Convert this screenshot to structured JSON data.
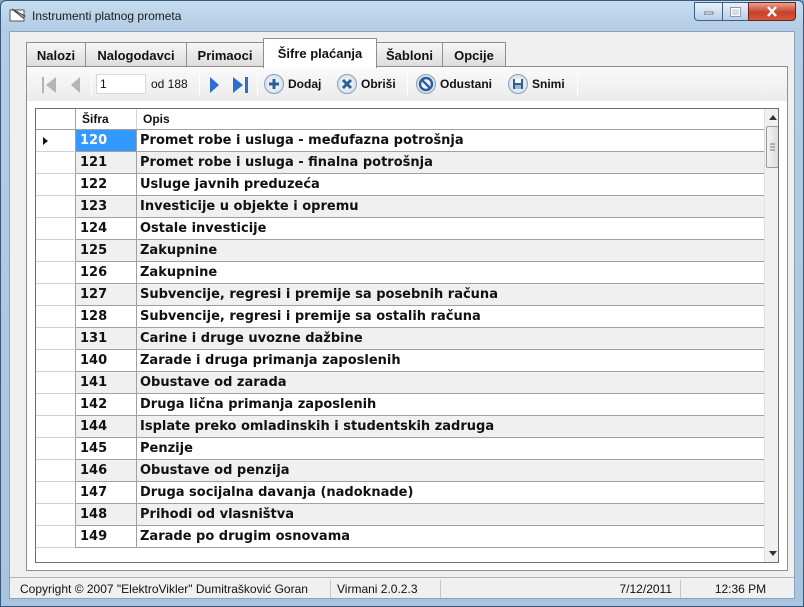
{
  "window": {
    "title": "Instrumenti platnog prometa"
  },
  "tabs": [
    {
      "label": "Nalozi"
    },
    {
      "label": "Nalogodavci"
    },
    {
      "label": "Primaoci"
    },
    {
      "label": "Šifre plaćanja"
    },
    {
      "label": "Šabloni"
    },
    {
      "label": "Opcije"
    }
  ],
  "active_tab": "Šifre plaćanja",
  "toolbar": {
    "position": "1",
    "of_label": "od 188",
    "add_label": "Dodaj",
    "delete_label": "Obriši",
    "cancel_label": "Odustani",
    "save_label": "Snimi"
  },
  "grid": {
    "columns": {
      "code": "Šifra",
      "desc": "Opis"
    },
    "rows": [
      {
        "code": "120",
        "desc": "Promet robe i usluga - međufazna potrošnja"
      },
      {
        "code": "121",
        "desc": "Promet robe i usluga - finalna potrošnja"
      },
      {
        "code": "122",
        "desc": "Usluge javnih preduzeća"
      },
      {
        "code": "123",
        "desc": "Investicije u objekte i opremu"
      },
      {
        "code": "124",
        "desc": "Ostale investicije"
      },
      {
        "code": "125",
        "desc": "Zakupnine"
      },
      {
        "code": "126",
        "desc": "Zakupnine"
      },
      {
        "code": "127",
        "desc": "Subvencije, regresi i premije sa posebnih računa"
      },
      {
        "code": "128",
        "desc": "Subvencije, regresi i premije sa ostalih računa"
      },
      {
        "code": "131",
        "desc": "Carine i druge uvozne dažbine"
      },
      {
        "code": "140",
        "desc": "Zarade i druga primanja zaposlenih"
      },
      {
        "code": "141",
        "desc": "Obustave od zarada"
      },
      {
        "code": "142",
        "desc": "Druga lična primanja zaposlenih"
      },
      {
        "code": "144",
        "desc": "Isplate preko omladinskih i studentskih zadruga"
      },
      {
        "code": "145",
        "desc": "Penzije"
      },
      {
        "code": "146",
        "desc": "Obustave od penzija"
      },
      {
        "code": "147",
        "desc": "Druga socijalna davanja (nadoknade)"
      },
      {
        "code": "148",
        "desc": "Prihodi  od vlasništva"
      },
      {
        "code": "149",
        "desc": "Zarade po drugim osnovama"
      }
    ]
  },
  "status": {
    "copyright": "Copyright © 2007 \"ElektroVikler\" Dumitrašković Goran",
    "version": "Virmani 2.0.2.3",
    "date": "7/12/2011",
    "time": "12:36 PM"
  },
  "colors": {
    "selection": "#3399ff",
    "alt_row": "#f0f0f0"
  }
}
